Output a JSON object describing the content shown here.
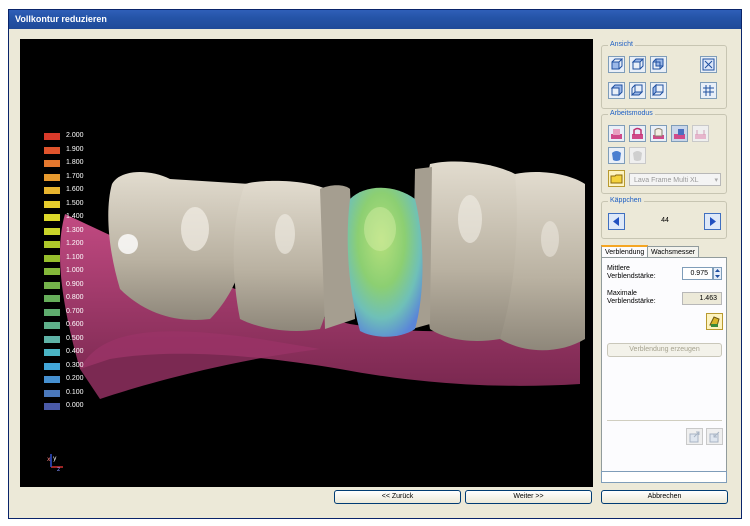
{
  "window": {
    "title": "Vollkontur reduzieren"
  },
  "legend": {
    "items": [
      {
        "label": "2.000",
        "color": "#d83a2a"
      },
      {
        "label": "1.900",
        "color": "#e0542c"
      },
      {
        "label": "1.800",
        "color": "#e5782e"
      },
      {
        "label": "1.700",
        "color": "#e89a2e"
      },
      {
        "label": "1.600",
        "color": "#e8b42e"
      },
      {
        "label": "1.500",
        "color": "#e6cc2c"
      },
      {
        "label": "1.400",
        "color": "#dcd82a"
      },
      {
        "label": "1.300",
        "color": "#c9d42a"
      },
      {
        "label": "1.200",
        "color": "#aec82a"
      },
      {
        "label": "1.100",
        "color": "#96be2c"
      },
      {
        "label": "1.000",
        "color": "#84b83a"
      },
      {
        "label": "0.900",
        "color": "#74b24a"
      },
      {
        "label": "0.800",
        "color": "#66ae5a"
      },
      {
        "label": "0.700",
        "color": "#5eac6e"
      },
      {
        "label": "0.600",
        "color": "#5eb08a"
      },
      {
        "label": "0.500",
        "color": "#5eb2a6"
      },
      {
        "label": "0.400",
        "color": "#4ab4c4"
      },
      {
        "label": "0.300",
        "color": "#42a6d8"
      },
      {
        "label": "0.200",
        "color": "#4690d0"
      },
      {
        "label": "0.100",
        "color": "#4a78bc"
      },
      {
        "label": "0.000",
        "color": "#4a5aa8"
      }
    ]
  },
  "axes": {
    "x": "x",
    "y": "y",
    "z": "z"
  },
  "ansicht": {
    "title": "Ansicht",
    "buttons": [
      "view-front-icon",
      "view-top-icon",
      "view-back-icon",
      "fit-view-icon",
      "view-left-icon",
      "view-bottom-icon",
      "view-right-icon",
      "grid-icon"
    ]
  },
  "arbeitsmodus": {
    "title": "Arbeitsmodus",
    "buttons": [
      "mode-reduce-icon",
      "mode-cutback-icon",
      "mode-coping-icon",
      "mode-selected-icon",
      "mode-disabled-icon",
      "mode-tooth-icon",
      "mode-tooth-disabled-icon"
    ],
    "material_select": "Lava Frame Multi XL"
  },
  "kaeppchen": {
    "title": "Käppchen",
    "value": "44"
  },
  "tabs": {
    "active": "Verblendung",
    "other": "Wachsmesser"
  },
  "form": {
    "mittlere_label_1": "Mittlere",
    "mittlere_label_2": "Verblendstärke:",
    "mittlere_value": "0.975",
    "maximale_label_1": "Maximale",
    "maximale_label_2": "Verblendstärke:",
    "maximale_value": "1.463",
    "create_button": "Verblendung erzeugen"
  },
  "nav": {
    "back": "<< Zurück",
    "next": "Weiter >>",
    "cancel": "Abbrechen"
  },
  "colors": {
    "accent": "#f5a623",
    "title_bar": "#2554a8",
    "gum": "#a83a6e",
    "tooth": "#c8c0b0"
  }
}
